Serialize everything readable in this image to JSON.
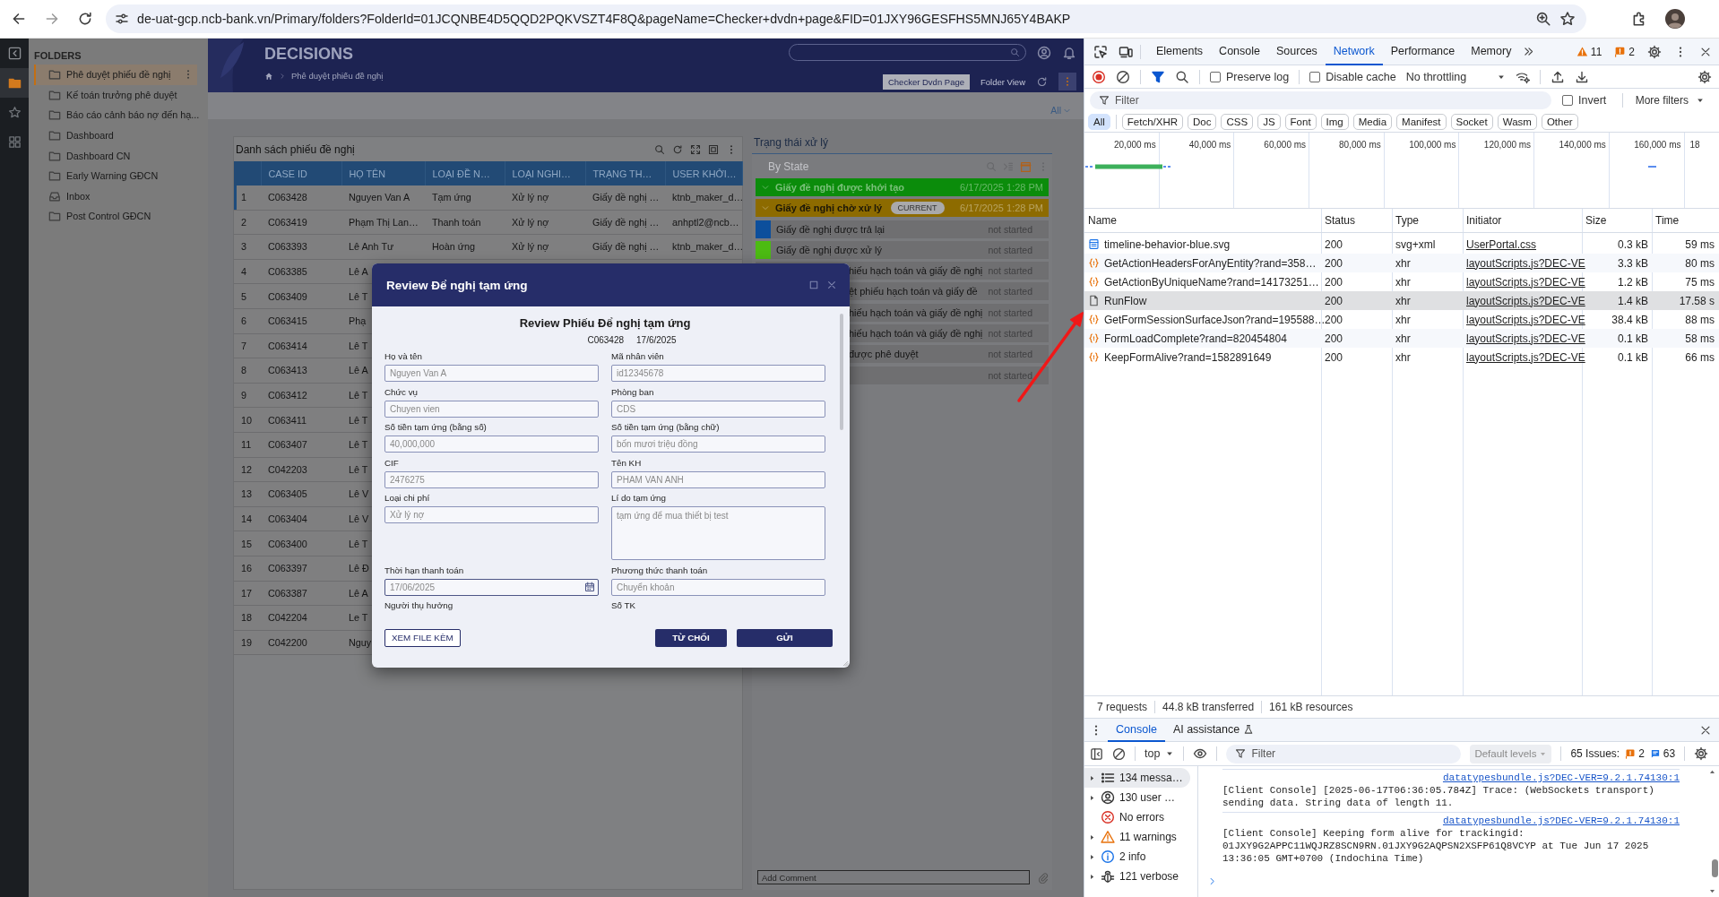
{
  "browser": {
    "url": "de-uat-gcp.ncb-bank.vn/Primary/folders?FolderId=01JCQNBE4D5QQD2PQKVSZT4F8Q&pageName=Checker+dvdn+page&FID=01JXY96GESFHS5MNJ65Y4BAKP"
  },
  "app": {
    "sidebar": {
      "title": "FOLDERS",
      "items": [
        {
          "label": "Phê duyệt phiếu đề nghị",
          "kind": "folder",
          "selected": true
        },
        {
          "label": "Kế toán trưởng phê duyệt",
          "kind": "folder",
          "selected": false
        },
        {
          "label": "Báo cáo cảnh báo nợ đến hạ...",
          "kind": "folder",
          "selected": false
        },
        {
          "label": "Dashboard",
          "kind": "folder",
          "selected": false
        },
        {
          "label": "Dashboard CN",
          "kind": "folder",
          "selected": false
        },
        {
          "label": "Early Warning GĐCN",
          "kind": "folder",
          "selected": false
        },
        {
          "label": "Inbox",
          "kind": "inbox",
          "selected": false
        },
        {
          "label": "Post Control GĐCN",
          "kind": "folder",
          "selected": false
        }
      ]
    },
    "header": {
      "title": "DECISIONS",
      "breadcrumb": "Phê duyệt phiếu đề nghị",
      "page_button": "Checker Dvdn Page",
      "view_button": "Folder View",
      "filter": "All"
    },
    "table": {
      "title": "Danh sách phiếu đề nghị",
      "columns": [
        "CASE ID",
        "HỌ TÊN",
        "LOẠI ĐỀ N…",
        "LOẠI NGHI…",
        "TRẠNG TH…",
        "USER KHỞI…"
      ],
      "rows": [
        {
          "index": "1",
          "cells": [
            "C063428",
            "Nguyen Van A",
            "Tạm ứng",
            "Xử lý nợ",
            "Giấy đề nghị …",
            "ktnb_maker_d…"
          ],
          "selected": true
        },
        {
          "index": "2",
          "cells": [
            "C063419",
            "Phạm Thị Lan…",
            "Thanh toán",
            "Xử lý nợ",
            "Giấy đề nghị …",
            "anhptl2@ncb…"
          ],
          "selected": false
        },
        {
          "index": "3",
          "cells": [
            "C063393",
            "Lê Anh Tư",
            "Hoàn ứng",
            "Xử lý nợ",
            "Giấy đề nghị …",
            "ktnb_maker_d…"
          ],
          "selected": false
        },
        {
          "index": "4",
          "cells": [
            "C063385",
            "Lê A"
          ],
          "selected": false
        },
        {
          "index": "5",
          "cells": [
            "C063409",
            "Lê T"
          ],
          "selected": false
        },
        {
          "index": "6",
          "cells": [
            "C063415",
            "Phạ"
          ],
          "selected": false
        },
        {
          "index": "7",
          "cells": [
            "C063414",
            "Lê T"
          ],
          "selected": false
        },
        {
          "index": "8",
          "cells": [
            "C063413",
            "Lê A"
          ],
          "selected": false
        },
        {
          "index": "9",
          "cells": [
            "C063412",
            "Lê T"
          ],
          "selected": false
        },
        {
          "index": "10",
          "cells": [
            "C063411",
            "Lê T"
          ],
          "selected": false
        },
        {
          "index": "11",
          "cells": [
            "C063407",
            "Lê T"
          ],
          "selected": false
        },
        {
          "index": "12",
          "cells": [
            "C042203",
            "Lê T"
          ],
          "selected": false
        },
        {
          "index": "13",
          "cells": [
            "C063405",
            "Lê V"
          ],
          "selected": false
        },
        {
          "index": "14",
          "cells": [
            "C063404",
            "Lê V"
          ],
          "selected": false
        },
        {
          "index": "15",
          "cells": [
            "C063400",
            "Lê T"
          ],
          "selected": false
        },
        {
          "index": "16",
          "cells": [
            "C063397",
            "Lê Đ"
          ],
          "selected": false
        },
        {
          "index": "17",
          "cells": [
            "C063387",
            "Lê A"
          ],
          "selected": false
        },
        {
          "index": "18",
          "cells": [
            "C042204",
            "Le T"
          ],
          "selected": false
        },
        {
          "index": "19",
          "cells": [
            "C042200",
            "Nguy"
          ],
          "selected": false
        }
      ]
    },
    "status": {
      "title": "Trạng thái xử lý",
      "view": "By State",
      "items": [
        {
          "kind": "stage",
          "label": "Giấy đề nghị được khởi tạo",
          "time": "6/17/2025 1:28 PM",
          "color": "#0b8c0b",
          "current": false
        },
        {
          "kind": "stage",
          "label": "Giấy đề nghị chờ xử lý",
          "badge": "CURRENT",
          "time": "6/17/2025 1:28 PM",
          "color": "#8d6b00",
          "current": true
        },
        {
          "kind": "step",
          "label": "Giấy đề nghị được trả lại",
          "time": "not started",
          "color": "#0d4f9c"
        },
        {
          "kind": "step",
          "label": "Giấy đề nghị được xử lý",
          "time": "not started",
          "color": "#4cbb12"
        },
        {
          "kind": "covered",
          "label": "hiếu hạch toán và giấy đề nghị",
          "time": "not started"
        },
        {
          "kind": "covered",
          "label": "ệt phiếu hạch toán và giấy đề",
          "time": "not started"
        },
        {
          "kind": "covered",
          "label": "hiếu hạch toán và giấy đề nghị",
          "time": "not started"
        },
        {
          "kind": "covered",
          "label": "hiếu hạch toán và giấy đề nghị",
          "time": "not started"
        },
        {
          "kind": "covered",
          "label": "được phê duyệt",
          "time": "not started"
        },
        {
          "kind": "covered",
          "time": "not started"
        }
      ]
    },
    "comment": {
      "placeholder": "Add Comment"
    }
  },
  "modal": {
    "title": "Review Để nghị tạm ứng",
    "heading": "Review Phiếu Để nghị tạm ứng",
    "case_id": "C063428",
    "date": "17/6/2025",
    "fields": [
      {
        "label": "Họ và tên",
        "kind": "input",
        "value": "Nguyen Van A"
      },
      {
        "label": "Mã nhân viên",
        "kind": "input",
        "value": "id12345678"
      },
      {
        "label": "Chức vụ",
        "kind": "input",
        "value": "Chuyen vien"
      },
      {
        "label": "Phòng ban",
        "kind": "input",
        "value": "CDS"
      },
      {
        "label": "Số tiền tạm ứng (bằng số)",
        "kind": "input",
        "value": "40,000,000"
      },
      {
        "label": "Số tiền tạm ứng (bằng chữ)",
        "kind": "input",
        "value": "bốn mươi triệu đồng"
      },
      {
        "label": "CIF",
        "kind": "input",
        "value": "2476275"
      },
      {
        "label": "Tên KH",
        "kind": "input",
        "value": "PHAM VAN ANH"
      },
      {
        "label": "Loại chi phí",
        "kind": "input",
        "value": "Xử lý nợ"
      },
      {
        "label": "Lí do tạm ứng",
        "kind": "textarea",
        "value": "tạm ứng để mua thiết bị test"
      },
      {
        "label": "Thời hạn thanh toán",
        "kind": "date",
        "value": "17/06/2025"
      },
      {
        "label": "Phương thức thanh toán",
        "kind": "input",
        "value": "Chuyển khoản"
      },
      {
        "label": "Người thụ hưởng",
        "kind": "label"
      },
      {
        "label": "Số TK",
        "kind": "label"
      }
    ],
    "buttons": [
      {
        "label": "XEM FILE KÈM",
        "kind": "outline"
      },
      {
        "label": "TỪ CHỐI",
        "kind": "primary"
      },
      {
        "label": "GỬI",
        "kind": "primary"
      }
    ]
  },
  "devtools": {
    "tabs": [
      {
        "label": "Elements",
        "selected": false
      },
      {
        "label": "Console",
        "selected": false
      },
      {
        "label": "Sources",
        "selected": false
      },
      {
        "label": "Network",
        "selected": true
      },
      {
        "label": "Performance",
        "selected": false
      },
      {
        "label": "Memory",
        "selected": false
      }
    ],
    "warnings": "11",
    "errors": "2",
    "preserve_log": {
      "label": "Preserve log",
      "checked": false
    },
    "disable_cache": {
      "label": "Disable cache",
      "checked": false
    },
    "throttling": "No throttling",
    "filter": {
      "placeholder": "Filter"
    },
    "invert": {
      "label": "Invert",
      "checked": false
    },
    "more_filters": "More filters",
    "types": [
      {
        "label": "All",
        "selected": true
      },
      {
        "label": "Fetch/XHR",
        "selected": false
      },
      {
        "label": "Doc",
        "selected": false
      },
      {
        "label": "CSS",
        "selected": false
      },
      {
        "label": "JS",
        "selected": false
      },
      {
        "label": "Font",
        "selected": false
      },
      {
        "label": "Img",
        "selected": false
      },
      {
        "label": "Media",
        "selected": false
      },
      {
        "label": "Manifest",
        "selected": false
      },
      {
        "label": "Socket",
        "selected": false
      },
      {
        "label": "Wasm",
        "selected": false
      },
      {
        "label": "Other",
        "selected": false
      }
    ],
    "timeline_ticks": [
      "20,000 ms",
      "40,000 ms",
      "60,000 ms",
      "80,000 ms",
      "100,000 ms",
      "120,000 ms",
      "140,000 ms",
      "160,000 ms",
      "18"
    ],
    "columns": [
      "Name",
      "Status",
      "Type",
      "Initiator",
      "Size",
      "Time"
    ],
    "requests": [
      {
        "kind": "svg",
        "name": "timeline-behavior-blue.svg",
        "status": "200",
        "type": "svg+xml",
        "initiator": "UserPortal.css",
        "size": "0.3 kB",
        "time": "59 ms",
        "selected": false
      },
      {
        "kind": "xhr",
        "name": "GetActionHeadersForAnyEntity?rand=358…",
        "status": "200",
        "type": "xhr",
        "initiator": "layoutScripts.js?DEC-VE",
        "size": "3.3 kB",
        "time": "80 ms",
        "selected": false
      },
      {
        "kind": "xhr",
        "name": "GetActionByUniqueName?rand=14173251…",
        "status": "200",
        "type": "xhr",
        "initiator": "layoutScripts.js?DEC-VE",
        "size": "1.2 kB",
        "time": "75 ms",
        "selected": false
      },
      {
        "kind": "doc",
        "name": "RunFlow",
        "status": "200",
        "type": "xhr",
        "initiator": "layoutScripts.js?DEC-VE",
        "size": "1.4 kB",
        "time": "17.58 s",
        "selected": true
      },
      {
        "kind": "xhr",
        "name": "GetFormSessionSurfaceJson?rand=195588…",
        "status": "200",
        "type": "xhr",
        "initiator": "layoutScripts.js?DEC-VE",
        "size": "38.4 kB",
        "time": "88 ms",
        "selected": false
      },
      {
        "kind": "xhr",
        "name": "FormLoadComplete?rand=820454804",
        "status": "200",
        "type": "xhr",
        "initiator": "layoutScripts.js?DEC-VE",
        "size": "0.1 kB",
        "time": "58 ms",
        "selected": false
      },
      {
        "kind": "xhr",
        "name": "KeepFormAlive?rand=1582891649",
        "status": "200",
        "type": "xhr",
        "initiator": "layoutScripts.js?DEC-VE",
        "size": "0.1 kB",
        "time": "66 ms",
        "selected": false
      }
    ],
    "summary": [
      "7 requests",
      "44.8 kB transferred",
      "161 kB resources"
    ],
    "drawer_tabs": [
      {
        "label": "Console",
        "selected": true
      },
      {
        "label": "AI assistance",
        "selected": false
      }
    ],
    "context": "top",
    "console_filter": {
      "placeholder": "Filter"
    },
    "levels": "Default levels",
    "issues": "65 Issues:",
    "issue_errors": "2",
    "issue_info": "63",
    "console_sidebar": [
      {
        "kind": "messages",
        "label": "134 messa…",
        "expandable": true,
        "selected": true
      },
      {
        "kind": "user",
        "label": "130 user …",
        "expandable": true,
        "selected": false
      },
      {
        "kind": "errors",
        "label": "No errors",
        "expandable": false,
        "selected": false
      },
      {
        "kind": "warnings",
        "label": "11 warnings",
        "expandable": true,
        "selected": false
      },
      {
        "kind": "info",
        "label": "2 info",
        "expandable": true,
        "selected": false
      },
      {
        "kind": "verbose",
        "label": "121 verbose",
        "expandable": true,
        "selected": false
      }
    ],
    "messages": [
      {
        "text": "[Client Console] [2025-06-17T06:36:05.784Z] Trace: (WebSockets transport) sending data. String data of length 11.",
        "source": "datatypesbundle.js?DEC-VER=9.2.1.74130:1"
      },
      {
        "text": "[Client Console] Keeping form alive for trackingid: 01JXY9G2APPC11WQJRZ8SCN9RN.01JXY9G2AQPSN2XSFP61Q8VCYP at Tue Jun 17 2025 13:36:05 GMT+0700 (Indochina Time)",
        "source": "datatypesbundle.js?DEC-VER=9.2.1.74130:1"
      }
    ]
  }
}
